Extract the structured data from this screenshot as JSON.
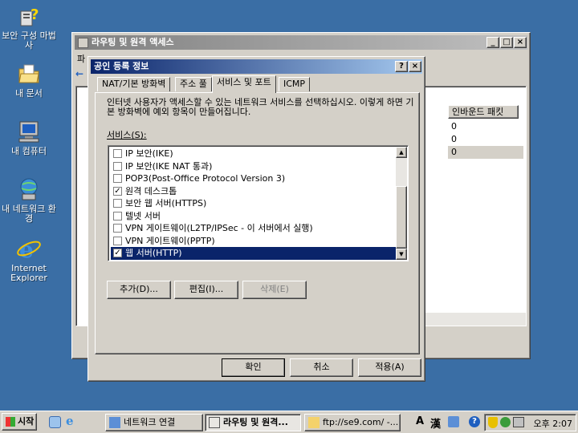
{
  "desktop": {
    "icons": [
      {
        "label": "보안 구성 마법사",
        "icon": "security-wizard-icon"
      },
      {
        "label": "내 문서",
        "icon": "folder-icon"
      },
      {
        "label": "내 컴퓨터",
        "icon": "computer-icon"
      },
      {
        "label": "내 네트워크 환경",
        "icon": "network-icon"
      },
      {
        "label": "Internet Explorer",
        "icon": "ie-icon"
      }
    ]
  },
  "bg_window": {
    "title": "라우팅 및 원격 액세스",
    "menu_partial": "파",
    "columns": [
      "인바운드 패킷"
    ],
    "rows": [
      {
        "value": "0"
      },
      {
        "value": "0"
      },
      {
        "value": "0"
      }
    ]
  },
  "dialog": {
    "title": "공인 등록 정보",
    "help_label": "?",
    "close_label": "×",
    "tabs": [
      "NAT/기본 방화벽",
      "주소 풀",
      "서비스 및 포트",
      "ICMP"
    ],
    "selected_tab": 2,
    "description": "인터넷 사용자가 액세스할 수 있는 네트워크 서비스를 선택하십시오. 이렇게 하면 기본 방화벽에 예외 항목이 만들어집니다.",
    "services_label": "서비스(S):",
    "services": [
      {
        "label": "IP 보안(IKE)",
        "checked": false
      },
      {
        "label": "IP 보안(IKE NAT 통과)",
        "checked": false
      },
      {
        "label": "POP3(Post-Office Protocol Version 3)",
        "checked": false
      },
      {
        "label": "원격 데스크톱",
        "checked": true
      },
      {
        "label": "보안 웹 서버(HTTPS)",
        "checked": false
      },
      {
        "label": "텔넷 서버",
        "checked": false
      },
      {
        "label": "VPN 게이트웨이(L2TP/IPSec - 이 서버에서 실행)",
        "checked": false
      },
      {
        "label": "VPN 게이트웨이(PPTP)",
        "checked": false
      },
      {
        "label": "웹 서버(HTTP)",
        "checked": true,
        "selected": true
      }
    ],
    "add_button": "추가(D)...",
    "edit_button": "편집(I)...",
    "delete_button": "삭제(E)",
    "ok_button": "확인",
    "cancel_button": "취소",
    "apply_button": "적용(A)"
  },
  "taskbar": {
    "start_label": "시작",
    "tasks": [
      {
        "label": "네트워크 연결",
        "active": false
      },
      {
        "label": "라우팅 및 원격...",
        "active": true
      },
      {
        "label": "ftp://se9.com/ -...",
        "active": false
      }
    ],
    "ime_a": "A",
    "ime_han": "漢",
    "clock": "오후 2:07"
  }
}
